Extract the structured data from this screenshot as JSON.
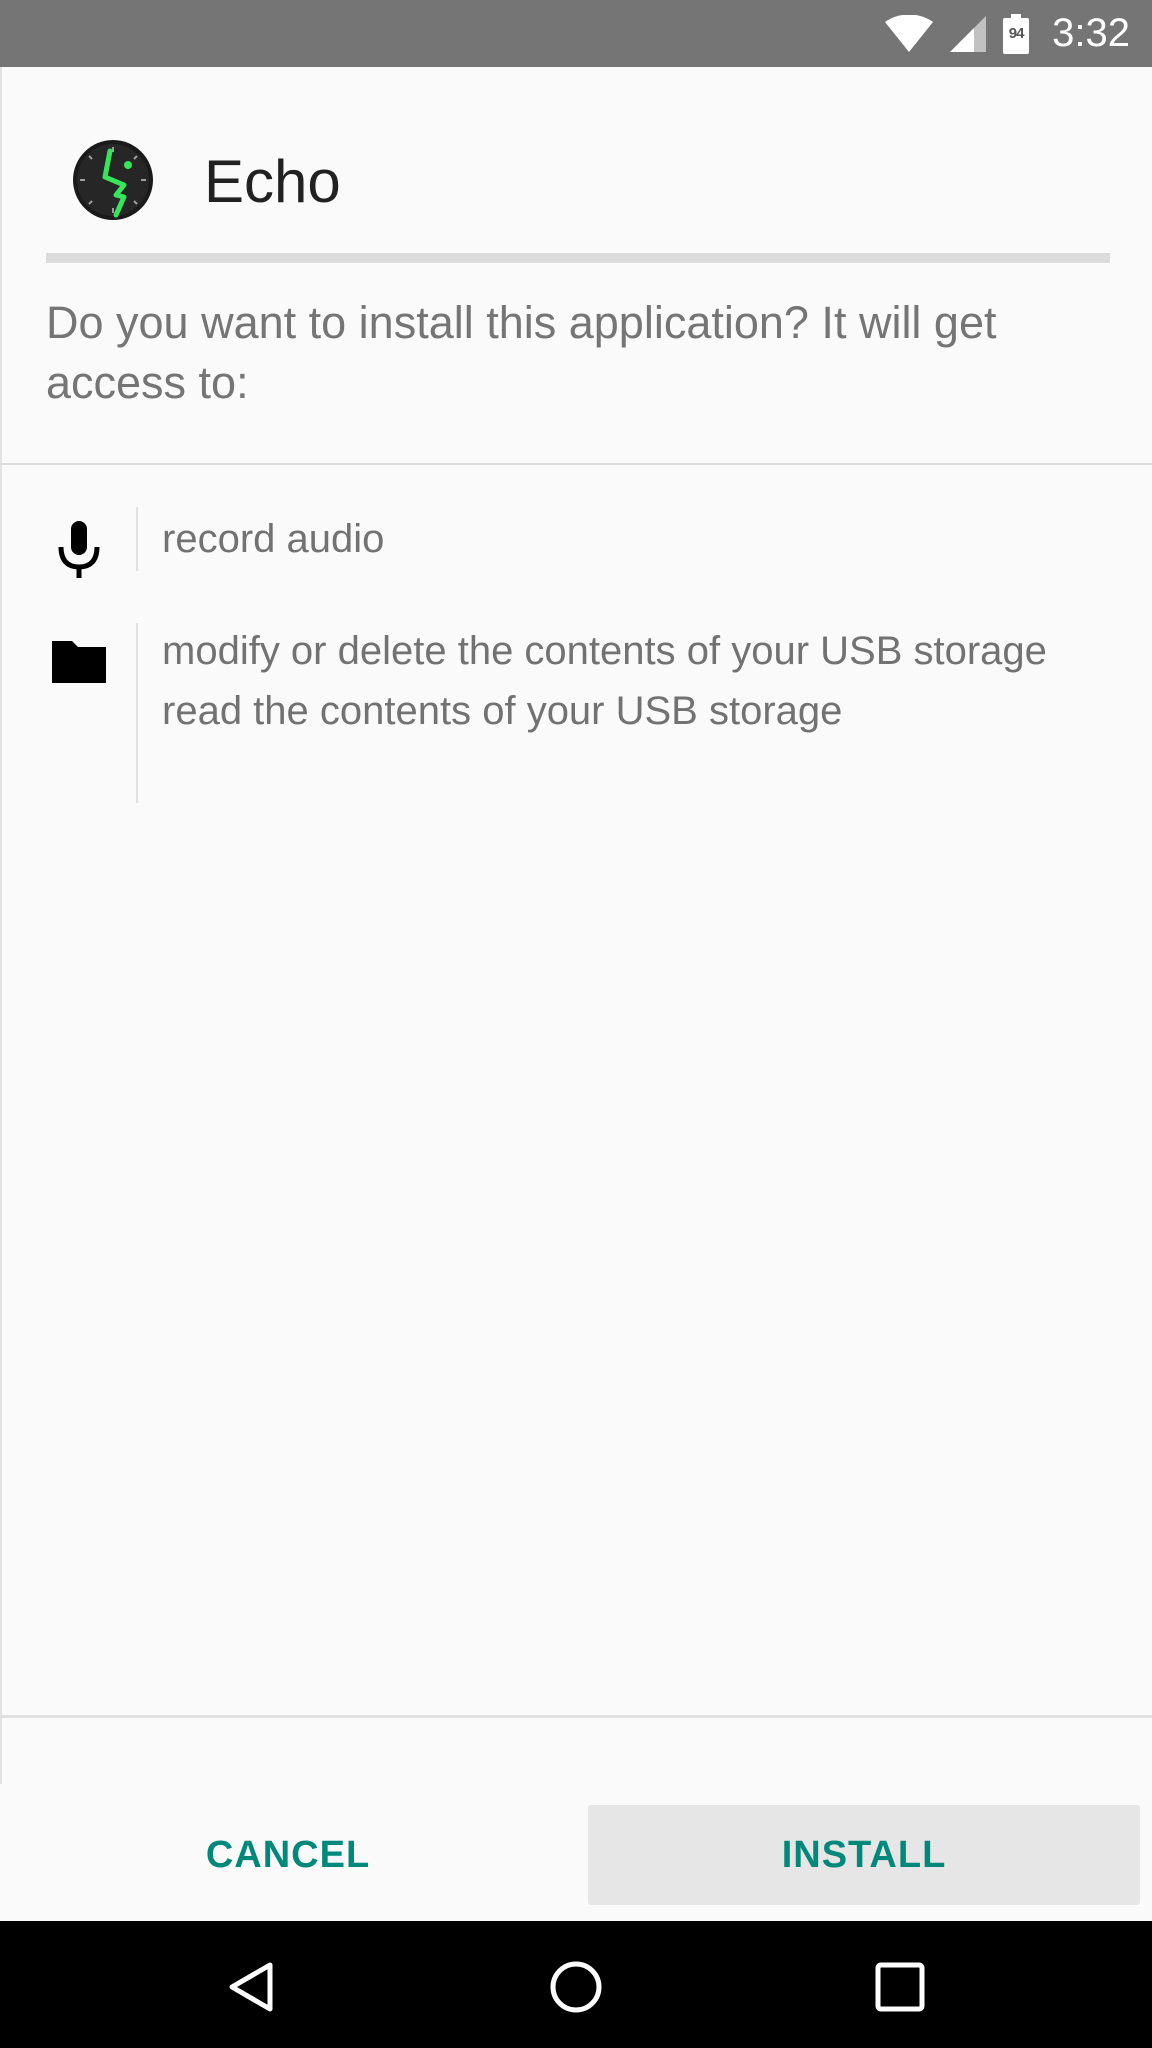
{
  "status_bar": {
    "time": "3:32",
    "battery_level": "94",
    "icons": [
      "wifi-icon",
      "cell-signal-icon",
      "battery-icon"
    ]
  },
  "app": {
    "name": "Echo",
    "icon": "echo-clock-icon"
  },
  "dialog": {
    "question": "Do you want to install this application? It will get access to:"
  },
  "permissions": [
    {
      "icon": "microphone-icon",
      "lines": [
        "record audio"
      ]
    },
    {
      "icon": "folder-icon",
      "lines": [
        "modify or delete the contents of your USB storage",
        "read the contents of your USB storage"
      ]
    }
  ],
  "actions": {
    "cancel_label": "CANCEL",
    "install_label": "INSTALL"
  },
  "nav_bar": {
    "buttons": [
      "back-icon",
      "home-icon",
      "recents-icon"
    ]
  },
  "colors": {
    "accent": "#00897b",
    "status_bar": "#757575",
    "icon_green": "#35e65a"
  }
}
